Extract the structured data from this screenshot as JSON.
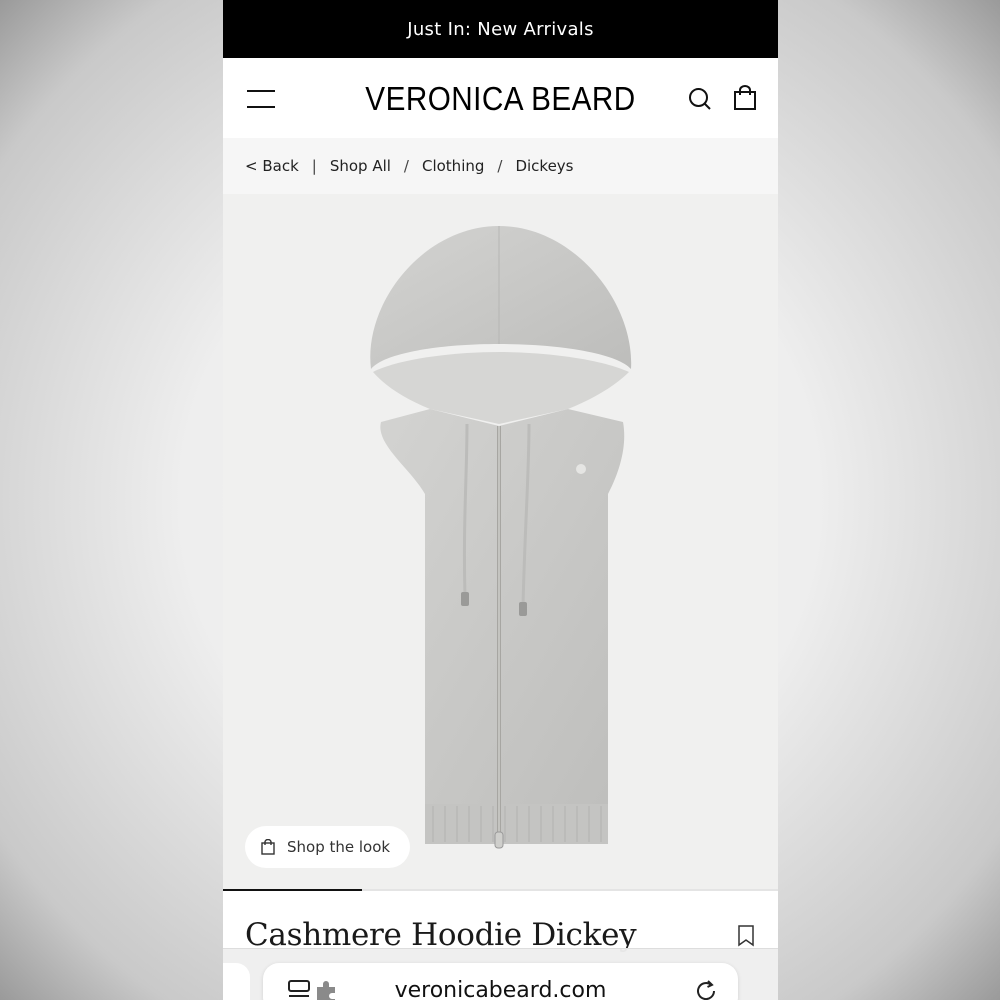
{
  "promo": {
    "text": "Just In: New Arrivals"
  },
  "header": {
    "logo": "VERONICA BEARD",
    "icons": {
      "menu": "menu-icon",
      "search": "search-icon",
      "bag": "shopping-bag-icon"
    }
  },
  "breadcrumb": {
    "back": "< Back",
    "divider": "|",
    "slash": "/",
    "items": [
      "Shop All",
      "Clothing",
      "Dickeys"
    ]
  },
  "product": {
    "image": "grey-cashmere-hoodie-dickey-photo",
    "shop_the_look": "Shop the look",
    "title": "Cashmere Hoodie Dickey",
    "carousel_position": 0.25
  },
  "browser": {
    "url": "veronicabeard.com",
    "icons": {
      "extensions": "page-menu-icon",
      "reload": "reload-icon"
    }
  },
  "colors": {
    "promo_bg": "#000000",
    "product_bg": "#f0f0ef",
    "hoodie": "#c9c9c7"
  }
}
